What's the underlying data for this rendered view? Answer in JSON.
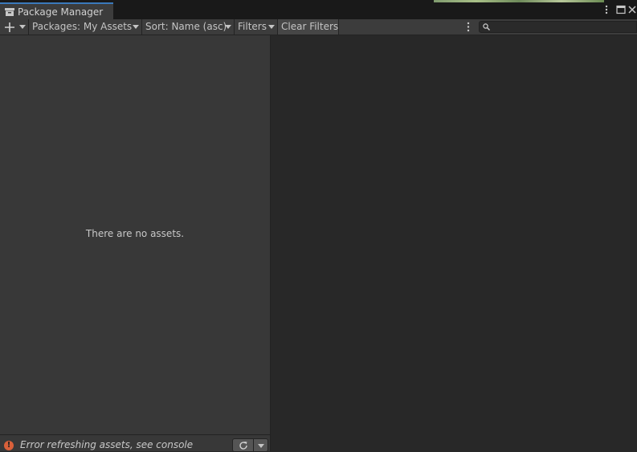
{
  "window": {
    "tab_title": "Package Manager",
    "tab_icon": "package-icon",
    "menu_icon": "kebab-menu-icon",
    "maximize_icon": "maximize-icon",
    "close_icon": "close-icon"
  },
  "toolbar": {
    "add_icon": "plus-icon",
    "packages_label": "Packages: My Assets",
    "sort_label": "Sort: Name (asc)",
    "filters_label": "Filters",
    "clear_filters_label": "Clear Filters",
    "more_icon": "kebab-menu-icon",
    "search": {
      "value": "",
      "placeholder": "",
      "icon": "search-icon"
    }
  },
  "list": {
    "empty_message": "There are no assets."
  },
  "status": {
    "error_icon": "error-icon",
    "message": "Error refreshing assets, see console",
    "refresh_icon": "refresh-icon",
    "dropdown_icon": "chevron-down-icon"
  },
  "colors": {
    "background": "#282828",
    "panel": "#383838",
    "toolbar": "#3c3c3c",
    "tab_accent": "#3a79bb",
    "error": "#d9603a"
  }
}
